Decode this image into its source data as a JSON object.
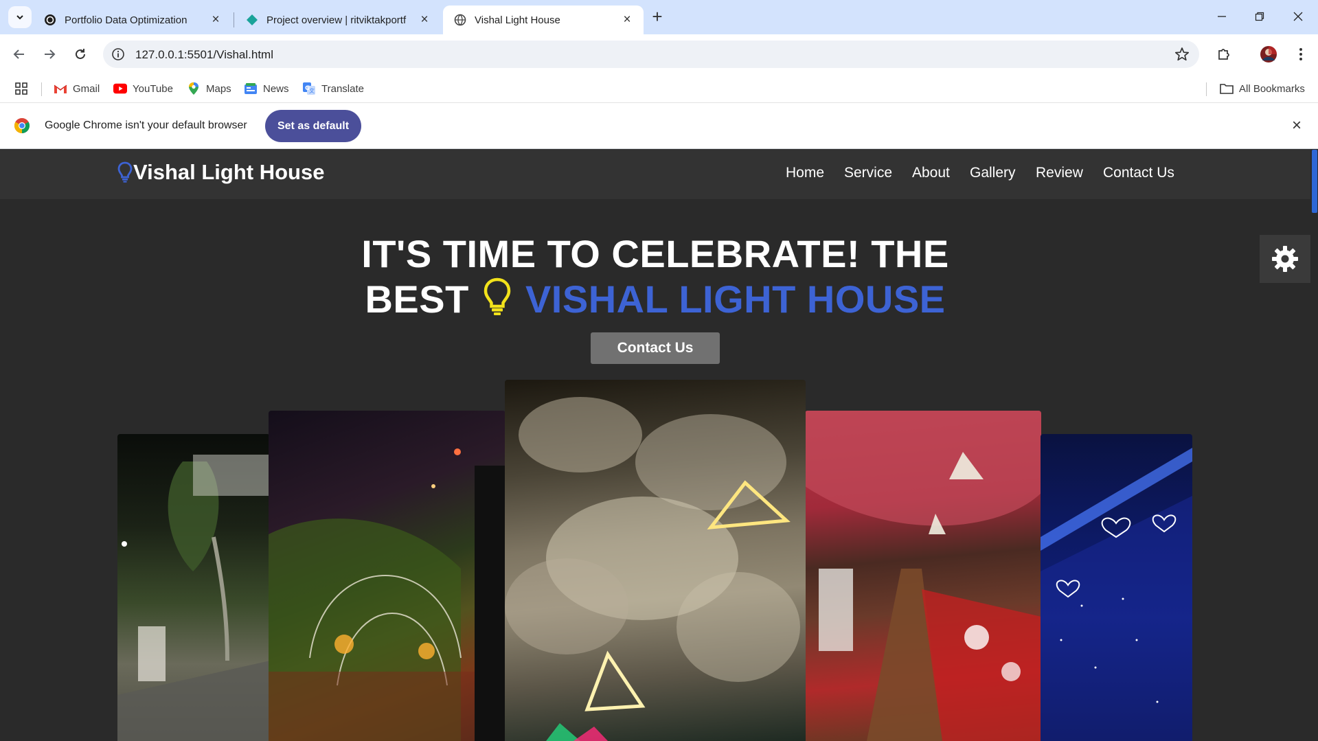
{
  "browser": {
    "tabs": [
      {
        "title": "Portfolio Data Optimization",
        "icon": "openai-icon",
        "active": false
      },
      {
        "title": "Project overview | ritviktakportf",
        "icon": "firebase-diamond-icon",
        "active": false
      },
      {
        "title": "Vishal Light House",
        "icon": "globe-icon",
        "active": true
      }
    ],
    "url": "127.0.0.1:5501/Vishal.html",
    "bookmarks": [
      {
        "label": "Gmail",
        "icon": "gmail-icon"
      },
      {
        "label": "YouTube",
        "icon": "youtube-icon"
      },
      {
        "label": "Maps",
        "icon": "maps-icon"
      },
      {
        "label": "News",
        "icon": "news-icon"
      },
      {
        "label": "Translate",
        "icon": "translate-icon"
      }
    ],
    "all_bookmarks": "All Bookmarks",
    "infobar": {
      "message": "Google Chrome isn't your default browser",
      "button": "Set as default"
    }
  },
  "site": {
    "brand": "Vishal Light House",
    "nav": [
      "Home",
      "Service",
      "About",
      "Gallery",
      "Review",
      "Contact Us"
    ],
    "hero": {
      "line1": "IT'S TIME TO CELEBRATE! THE",
      "line2_prefix": "BEST",
      "line2_accent": "VISHAL LIGHT HOUSE",
      "cta": "Contact Us"
    },
    "colors": {
      "accent": "#3d63d4",
      "nav_bg": "#333333",
      "page_bg": "#2a2a2a",
      "cta_bg": "#717171",
      "bulb": "#f2e21b"
    },
    "gallery": [
      {
        "name": "garden-entrance-photo"
      },
      {
        "name": "string-lights-arch-photo"
      },
      {
        "name": "lace-lantern-ceiling-photo"
      },
      {
        "name": "red-drapes-chandelier-photo"
      },
      {
        "name": "blue-fairy-lights-photo"
      }
    ]
  }
}
